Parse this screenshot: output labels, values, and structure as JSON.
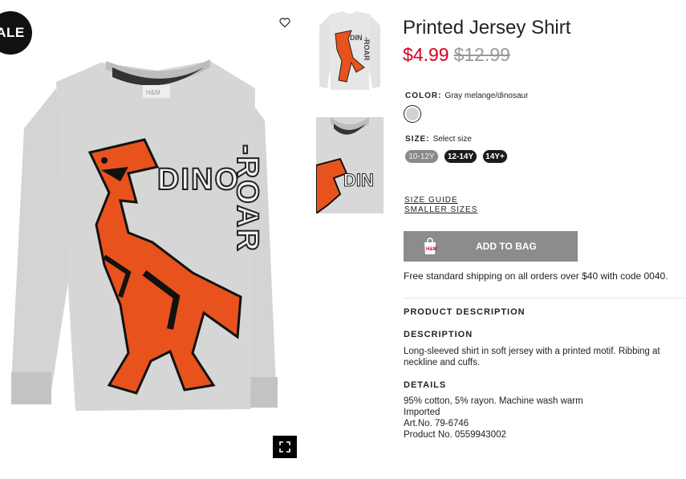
{
  "badge": {
    "sale": "ALE"
  },
  "product": {
    "title": "Printed Jersey Shirt",
    "price": "$4.99",
    "old_price": "$12.99",
    "color_label": "COLOR:",
    "color_value": "Gray melange/dinosaur",
    "size_label": "SIZE:",
    "size_value": "Select size",
    "sizes": [
      "10-12Y",
      "12-14Y",
      "14Y+"
    ],
    "size_guide": "SIZE GUIDE",
    "smaller_sizes": "SMALLER SIZES",
    "add_to_bag": "ADD TO BAG",
    "shipping": "Free standard shipping on all orders over $40 with code 0040."
  },
  "description": {
    "section_title": "PRODUCT DESCRIPTION",
    "description_label": "DESCRIPTION",
    "description_text": "Long-sleeved shirt in soft jersey with a printed motif. Ribbing at neckline and cuffs.",
    "details_label": "DETAILS",
    "details": [
      "95% cotton, 5% rayon. Machine wash warm",
      "Imported",
      "Art.No. 79-6746",
      "Product No. 0559943002"
    ]
  },
  "image": {
    "print_text_1": "DINO",
    "print_text_2": "-ROAR",
    "brand_tag": "H&M"
  },
  "colors": {
    "price_red": "#d6001c",
    "shirt_gray": "#d2d2d2",
    "dino_orange": "#e8521d",
    "button_gray": "#8c8c8c"
  }
}
